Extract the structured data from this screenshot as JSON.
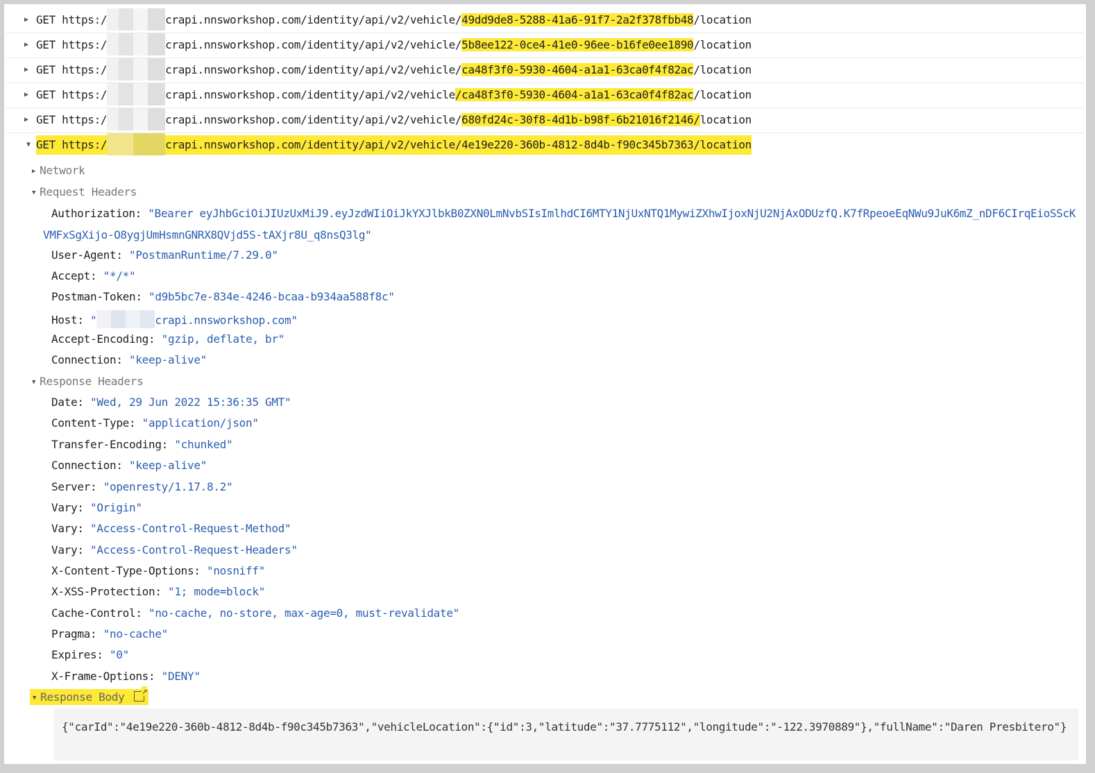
{
  "requests": [
    {
      "method": "GET",
      "prefix": "https:/",
      "host_suffix": "crapi.nnsworkshop.com/identity/api/v2/vehicle/",
      "id": "49dd9de8-5288-41a6-91f7-2a2f378fbb48",
      "tail": "/location"
    },
    {
      "method": "GET",
      "prefix": "https:/",
      "host_suffix": "crapi.nnsworkshop.com/identity/api/v2/vehicle/",
      "id": "5b8ee122-0ce4-41e0-96ee-b16fe0ee1890",
      "tail": "/location"
    },
    {
      "method": "GET",
      "prefix": "https:/",
      "host_suffix": "crapi.nnsworkshop.com/identity/api/v2/vehicle/",
      "id": "ca48f3f0-5930-4604-a1a1-63ca0f4f82ac",
      "tail": "/location"
    },
    {
      "method": "GET",
      "prefix": "https:/",
      "host_suffix": "crapi.nnsworkshop.com/identity/api/v2/vehicle",
      "id": "/ca48f3f0-5930-4604-a1a1-63ca0f4f82ac",
      "tail": "/location"
    },
    {
      "method": "GET",
      "prefix": "https:/",
      "host_suffix": "crapi.nnsworkshop.com/identity/api/v2/vehicle/",
      "id": "680fd24c-30f8-4d1b-b98f-6b21016f2146/",
      "tail": "location"
    },
    {
      "method": "GET",
      "prefix": "https:/",
      "host_suffix": "crapi.nnsworkshop.com/identity/api/v2/vehicle/",
      "id": "4e19e220-360b-4812-8d4b-f90c345b7363",
      "tail": "/location"
    }
  ],
  "sections": {
    "network": "Network",
    "request_headers": "Request Headers",
    "response_headers": "Response Headers",
    "response_body": "Response Body"
  },
  "request_headers": {
    "authorization_key": "Authorization:",
    "authorization_value": "\"Bearer eyJhbGciOiJIUzUxMiJ9.eyJzdWIiOiJkYXJlbkB0ZXN0LmNvbSIsImlhdCI6MTY1NjUxNTQ1MywiZXhwIjoxNjU2NjAxODUzfQ.K7fRpeoeEqNWu9JuK6mZ_nDF6CIrqEioSScKVMFxSgXijo-O8ygjUmHsmnGNRX8QVjd5S-tAXjr8U_q8nsQ3lg\"",
    "items": [
      {
        "key": "User-Agent:",
        "value": "\"PostmanRuntime/7.29.0\""
      },
      {
        "key": "Accept:",
        "value": "\"*/*\""
      },
      {
        "key": "Postman-Token:",
        "value": "\"d9b5bc7e-834e-4246-bcaa-b934aa588f8c\""
      }
    ],
    "host_key": "Host:",
    "host_value": "crapi.nnsworkshop.com\"",
    "items2": [
      {
        "key": "Accept-Encoding:",
        "value": "\"gzip, deflate, br\""
      },
      {
        "key": "Connection:",
        "value": "\"keep-alive\""
      }
    ]
  },
  "response_headers": [
    {
      "key": "Date:",
      "value": "\"Wed, 29 Jun 2022 15:36:35 GMT\""
    },
    {
      "key": "Content-Type:",
      "value": "\"application/json\""
    },
    {
      "key": "Transfer-Encoding:",
      "value": "\"chunked\""
    },
    {
      "key": "Connection:",
      "value": "\"keep-alive\""
    },
    {
      "key": "Server:",
      "value": "\"openresty/1.17.8.2\""
    },
    {
      "key": "Vary:",
      "value": "\"Origin\""
    },
    {
      "key": "Vary:",
      "value": "\"Access-Control-Request-Method\""
    },
    {
      "key": "Vary:",
      "value": "\"Access-Control-Request-Headers\""
    },
    {
      "key": "X-Content-Type-Options:",
      "value": "\"nosniff\""
    },
    {
      "key": "X-XSS-Protection:",
      "value": "\"1; mode=block\""
    },
    {
      "key": "Cache-Control:",
      "value": "\"no-cache, no-store, max-age=0, must-revalidate\""
    },
    {
      "key": "Pragma:",
      "value": "\"no-cache\""
    },
    {
      "key": "Expires:",
      "value": "\"0\""
    },
    {
      "key": "X-Frame-Options:",
      "value": "\"DENY\""
    }
  ],
  "response_body": "{\"carId\":\"4e19e220-360b-4812-8d4b-f90c345b7363\",\"vehicleLocation\":{\"id\":3,\"latitude\":\"37.7775112\",\"longitude\":\"-122.3970889\"},\"fullName\":\"Daren Presbitero\"}",
  "colors": {
    "highlight": "#fde936",
    "value_blue": "#2a5db0",
    "frame_border": "#d0d0d0"
  },
  "icons": {
    "collapsed": "triangle-right-icon",
    "expanded": "triangle-down-icon",
    "open_external": "external-link-icon"
  }
}
